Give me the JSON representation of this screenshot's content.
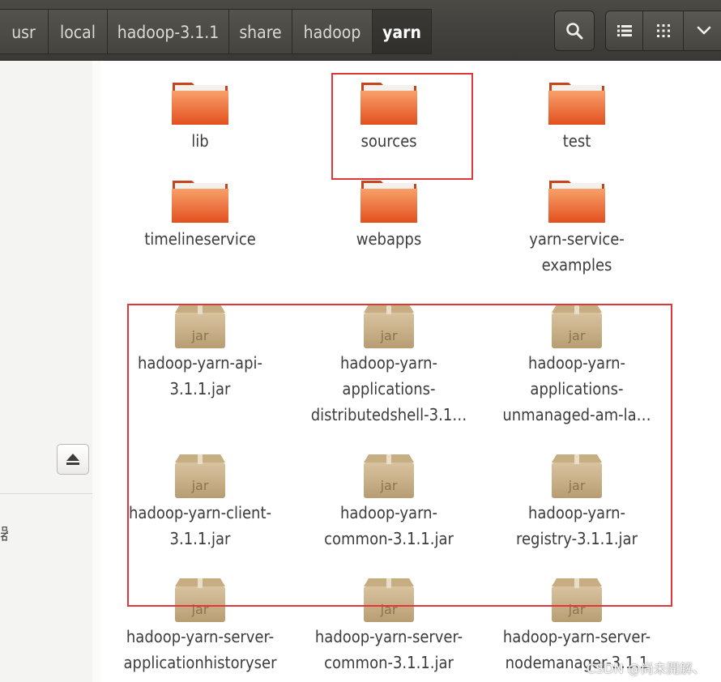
{
  "breadcrumbs": [
    {
      "label": "usr",
      "active": false
    },
    {
      "label": "local",
      "active": false
    },
    {
      "label": "hadoop-3.1.1",
      "active": false
    },
    {
      "label": "share",
      "active": false
    },
    {
      "label": "hadoop",
      "active": false
    },
    {
      "label": "yarn",
      "active": true
    }
  ],
  "toolbar": {
    "search_icon": "search-icon",
    "list_view_icon": "list-view-icon",
    "grid_view_icon": "grid-view-icon",
    "menu_icon": "chevron-down-icon"
  },
  "sidebar": {
    "eject_icon": "eject-icon",
    "partial_text": "器"
  },
  "folders": [
    {
      "name": "lib"
    },
    {
      "name": "sources"
    },
    {
      "name": "test"
    },
    {
      "name": "timelineservice"
    },
    {
      "name": "webapps"
    },
    {
      "name": "yarn-service-\nexamples"
    }
  ],
  "jars": [
    {
      "name": "hadoop-yarn-api-\n3.1.1.jar",
      "badge": "jar"
    },
    {
      "name": "hadoop-yarn-\napplications-\ndistributedshell-3.1…",
      "badge": "jar"
    },
    {
      "name": "hadoop-yarn-\napplications-\nunmanaged-am-la…",
      "badge": "jar"
    },
    {
      "name": "hadoop-yarn-client-\n3.1.1.jar",
      "badge": "jar"
    },
    {
      "name": "hadoop-yarn-\ncommon-3.1.1.jar",
      "badge": "jar"
    },
    {
      "name": "hadoop-yarn-\nregistry-3.1.1.jar",
      "badge": "jar"
    },
    {
      "name": "hadoop-yarn-server-\napplicationhistoryser",
      "badge": "jar"
    },
    {
      "name": "hadoop-yarn-server-\ncommon-3.1.1.jar",
      "badge": "jar"
    },
    {
      "name": "hadoop-yarn-server-\nnodemanager-3.1.1",
      "badge": "jar"
    }
  ],
  "watermark": "CSDN @尚未開解、",
  "colors": {
    "highlight": "#e0383a",
    "folder": "#e8562a",
    "header": "#3f3e3a"
  }
}
